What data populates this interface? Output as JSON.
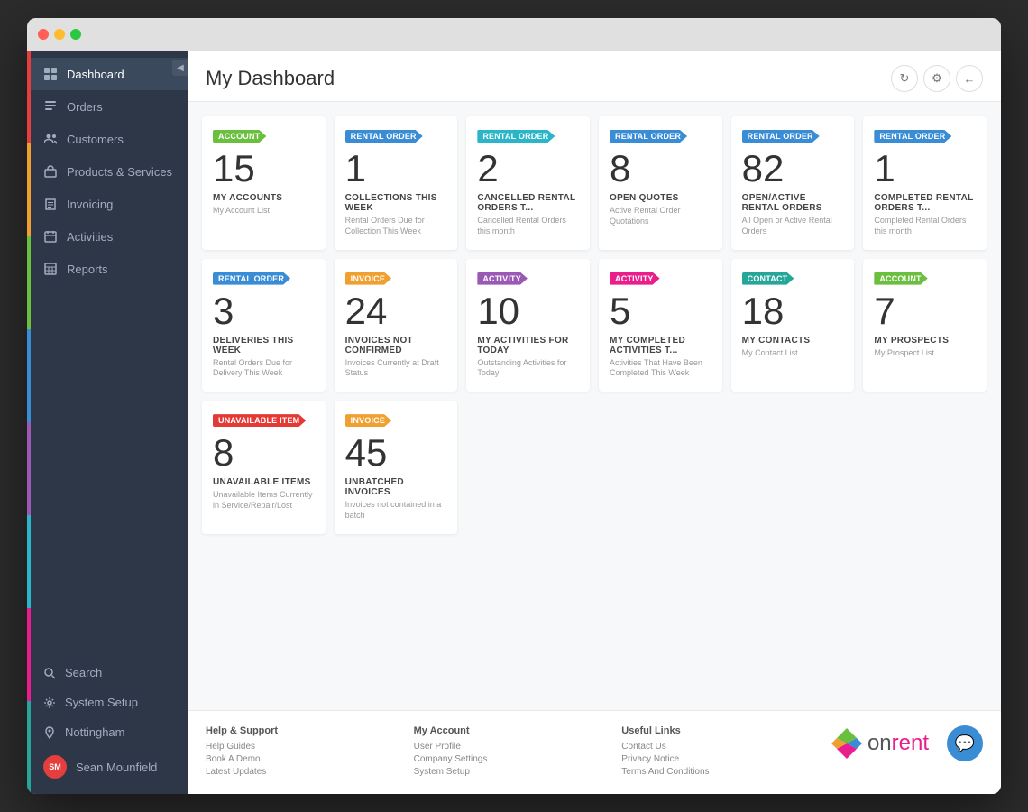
{
  "window": {
    "title": "My Dashboard"
  },
  "sidebar": {
    "collapse_icon": "◀",
    "color_bars": [
      "#e53e3e",
      "#f0a030",
      "#6abf3e",
      "#3a8dd4",
      "#9b59b6",
      "#2bb5c8",
      "#e91e8c",
      "#26a69a"
    ],
    "items": [
      {
        "id": "dashboard",
        "label": "Dashboard",
        "icon": "grid"
      },
      {
        "id": "orders",
        "label": "Orders",
        "icon": "list"
      },
      {
        "id": "customers",
        "label": "Customers",
        "icon": "users"
      },
      {
        "id": "products",
        "label": "Products & Services",
        "icon": "box"
      },
      {
        "id": "invoicing",
        "label": "Invoicing",
        "icon": "building"
      },
      {
        "id": "activities",
        "label": "Activities",
        "icon": "calendar"
      },
      {
        "id": "reports",
        "label": "Reports",
        "icon": "table"
      }
    ],
    "bottom_items": [
      {
        "id": "search",
        "label": "Search",
        "icon": "search"
      },
      {
        "id": "system-setup",
        "label": "System Setup",
        "icon": "gear"
      },
      {
        "id": "location",
        "label": "Nottingham",
        "icon": "pin"
      }
    ],
    "user": {
      "initials": "SM",
      "name": "Sean Mounfield"
    }
  },
  "header": {
    "title": "My Dashboard",
    "actions": [
      {
        "id": "refresh",
        "icon": "↻"
      },
      {
        "id": "settings",
        "icon": "⚙"
      },
      {
        "id": "back",
        "icon": "←"
      }
    ]
  },
  "cards_row1": [
    {
      "badge": "Account",
      "badge_color": "badge-green",
      "number": "15",
      "title": "MY ACCOUNTS",
      "subtitle": "My Account List"
    },
    {
      "badge": "Rental Order",
      "badge_color": "badge-blue",
      "number": "1",
      "title": "COLLECTIONS THIS WEEK",
      "subtitle": "Rental Orders Due for Collection This Week"
    },
    {
      "badge": "Rental Order",
      "badge_color": "badge-cyan",
      "number": "2",
      "title": "CANCELLED RENTAL ORDERS T...",
      "subtitle": "Cancelled Rental Orders this month"
    },
    {
      "badge": "Rental Order",
      "badge_color": "badge-blue",
      "number": "8",
      "title": "OPEN QUOTES",
      "subtitle": "Active Rental Order Quotations"
    },
    {
      "badge": "Rental Order",
      "badge_color": "badge-blue",
      "number": "82",
      "title": "OPEN/ACTIVE RENTAL ORDERS",
      "subtitle": "All Open or Active Rental Orders"
    },
    {
      "badge": "Rental Order",
      "badge_color": "badge-blue",
      "number": "1",
      "title": "COMPLETED RENTAL ORDERS T...",
      "subtitle": "Completed Rental Orders this month"
    }
  ],
  "cards_row2": [
    {
      "badge": "Rental Order",
      "badge_color": "badge-blue",
      "number": "3",
      "title": "DELIVERIES THIS WEEK",
      "subtitle": "Rental Orders Due for Delivery This Week"
    },
    {
      "badge": "Invoice",
      "badge_color": "badge-orange",
      "number": "24",
      "title": "INVOICES NOT CONFIRMED",
      "subtitle": "Invoices Currently at Draft Status"
    },
    {
      "badge": "Activity",
      "badge_color": "badge-purple",
      "number": "10",
      "title": "MY ACTIVITIES FOR TODAY",
      "subtitle": "Outstanding Activities for Today"
    },
    {
      "badge": "Activity",
      "badge_color": "badge-pink",
      "number": "5",
      "title": "MY COMPLETED ACTIVITIES T...",
      "subtitle": "Activities That Have Been Completed This Week"
    },
    {
      "badge": "Contact",
      "badge_color": "badge-teal",
      "number": "18",
      "title": "MY CONTACTS",
      "subtitle": "My Contact List"
    },
    {
      "badge": "Account",
      "badge_color": "badge-green",
      "number": "7",
      "title": "MY PROSPECTS",
      "subtitle": "My Prospect List"
    }
  ],
  "cards_row3": [
    {
      "badge": "Unavailable Item",
      "badge_color": "badge-red",
      "number": "8",
      "title": "UNAVAILABLE ITEMS",
      "subtitle": "Unavailable Items Currently in Service/Repair/Lost"
    },
    {
      "badge": "Invoice",
      "badge_color": "badge-orange",
      "number": "45",
      "title": "UNBATCHED INVOICES",
      "subtitle": "Invoices not contained in a batch"
    }
  ],
  "footer": {
    "help": {
      "heading": "Help & Support",
      "links": [
        "Help Guides",
        "Book A Demo",
        "Latest Updates"
      ]
    },
    "account": {
      "heading": "My Account",
      "links": [
        "User Profile",
        "Company Settings",
        "System Setup"
      ]
    },
    "useful": {
      "heading": "Useful Links",
      "links": [
        "Contact Us",
        "Privacy Notice",
        "Terms And Conditions"
      ]
    },
    "logo": {
      "on": "on",
      "rent": "rent"
    }
  }
}
